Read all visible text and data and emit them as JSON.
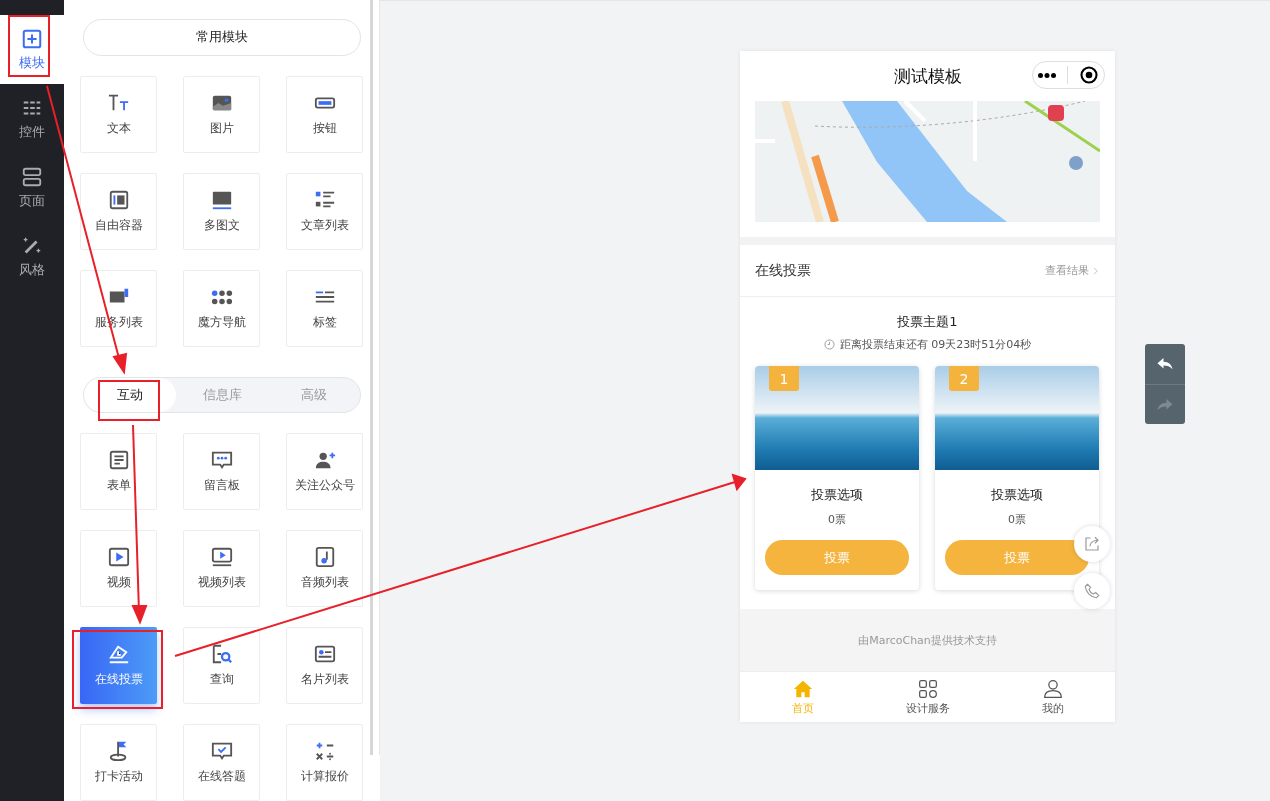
{
  "sidebar": {
    "items": [
      {
        "label": "模块",
        "selected": true
      },
      {
        "label": "控件",
        "selected": false
      },
      {
        "label": "页面",
        "selected": false
      },
      {
        "label": "风格",
        "selected": false
      }
    ]
  },
  "panel": {
    "common_header": "常用模块",
    "common_modules": [
      {
        "label": "文本"
      },
      {
        "label": "图片"
      },
      {
        "label": "按钮"
      },
      {
        "label": "自由容器"
      },
      {
        "label": "多图文"
      },
      {
        "label": "文章列表"
      },
      {
        "label": "服务列表"
      },
      {
        "label": "魔方导航"
      },
      {
        "label": "标签"
      }
    ],
    "tabs": [
      {
        "label": "互动",
        "selected": true
      },
      {
        "label": "信息库",
        "selected": false
      },
      {
        "label": "高级",
        "selected": false
      }
    ],
    "modules": [
      {
        "label": "表单",
        "selected": false
      },
      {
        "label": "留言板",
        "selected": false
      },
      {
        "label": "关注公众号",
        "selected": false
      },
      {
        "label": "视频",
        "selected": false
      },
      {
        "label": "视频列表",
        "selected": false
      },
      {
        "label": "音频列表",
        "selected": false
      },
      {
        "label": "在线投票",
        "selected": true
      },
      {
        "label": "查询",
        "selected": false
      },
      {
        "label": "名片列表",
        "selected": false
      },
      {
        "label": "打卡活动",
        "selected": false
      },
      {
        "label": "在线答题",
        "selected": false
      },
      {
        "label": "计算报价",
        "selected": false
      }
    ]
  },
  "phone": {
    "title": "测试模板",
    "section_title": "在线投票",
    "results_link": "查看结果",
    "topic": "投票主题1",
    "countdown": "距离投票结束还有 09天23时51分04秒",
    "options": [
      {
        "badge": "1",
        "name": "投票选项",
        "votes": "0票",
        "button": "投票"
      },
      {
        "badge": "2",
        "name": "投票选项",
        "votes": "0票",
        "button": "投票"
      }
    ],
    "footer": "由MarcoChan提供技术支持",
    "tabbar": [
      {
        "label": "首页",
        "selected": true
      },
      {
        "label": "设计服务",
        "selected": false
      },
      {
        "label": "我的",
        "selected": false
      }
    ]
  },
  "history_buttons": [
    {
      "kind": "undo",
      "disabled": false
    },
    {
      "kind": "redo",
      "disabled": true
    }
  ]
}
